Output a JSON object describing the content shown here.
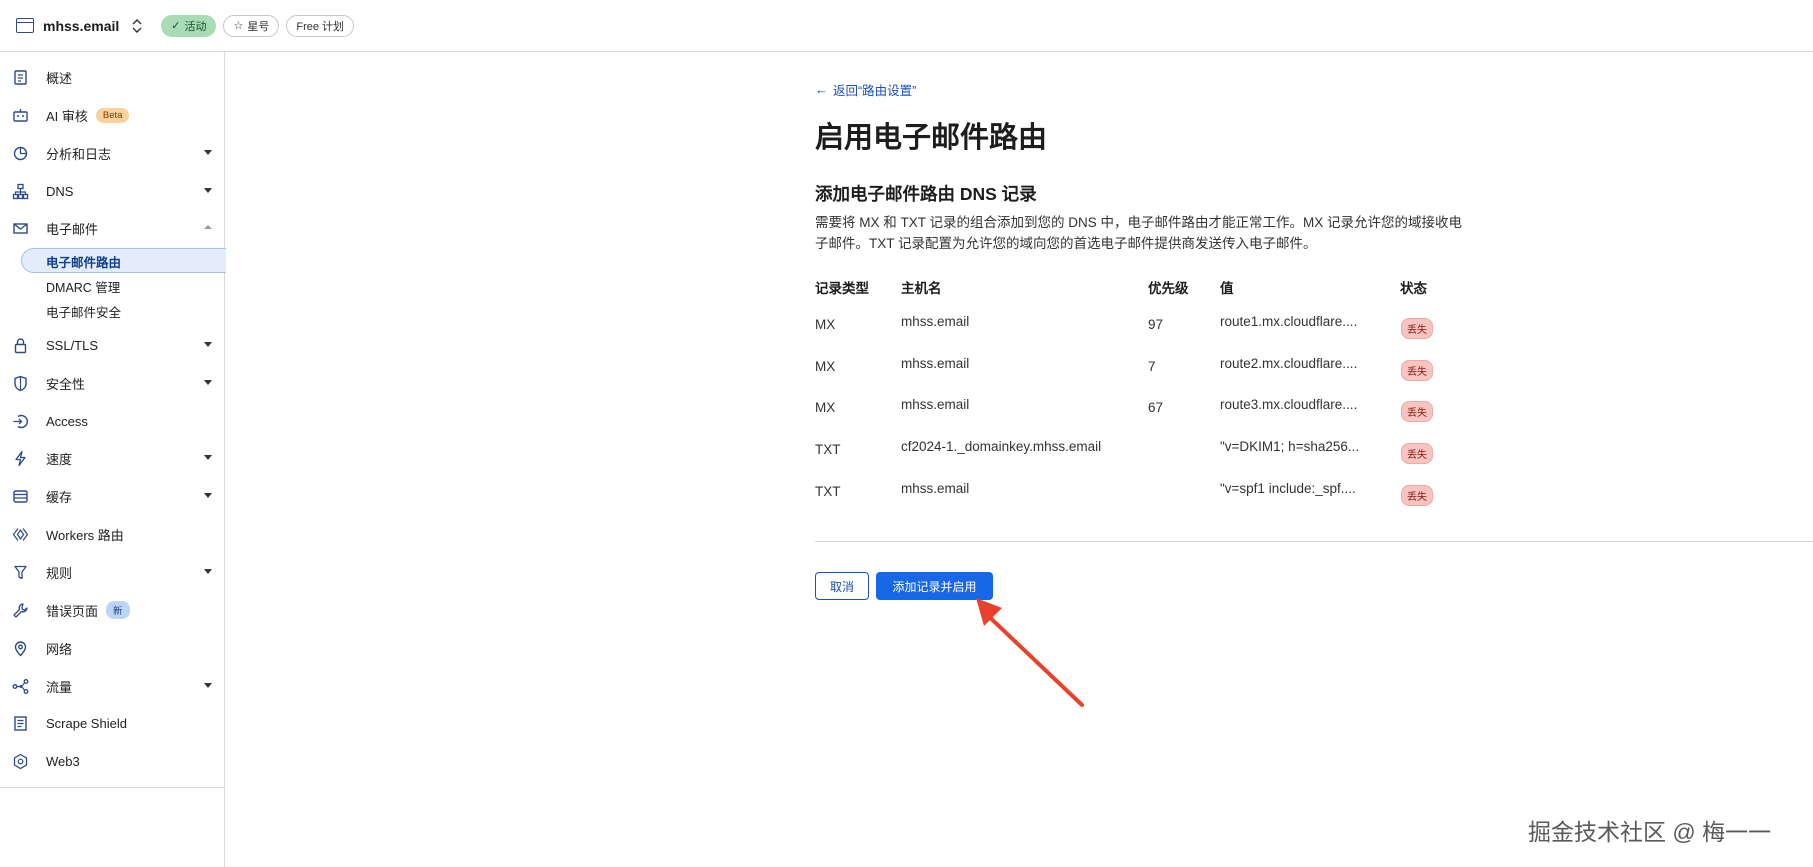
{
  "topbar": {
    "domain": "mhss.email",
    "status_label": "活动",
    "star_label": "星号",
    "plan_label": "Free 计划"
  },
  "sidebar": {
    "items": [
      {
        "label": "概述",
        "icon": "document-icon"
      },
      {
        "label": "AI 审核",
        "icon": "robot-icon",
        "badge": "Beta"
      },
      {
        "label": "分析和日志",
        "icon": "chart-pie-icon"
      },
      {
        "label": "DNS",
        "icon": "network-tree-icon"
      },
      {
        "label": "电子邮件",
        "icon": "mail-icon"
      },
      {
        "label": "SSL/TLS",
        "icon": "lock-icon"
      },
      {
        "label": "安全性",
        "icon": "shield-icon"
      },
      {
        "label": "Access",
        "icon": "access-icon"
      },
      {
        "label": "速度",
        "icon": "lightning-icon"
      },
      {
        "label": "缓存",
        "icon": "storage-icon"
      },
      {
        "label": "Workers 路由",
        "icon": "workers-icon"
      },
      {
        "label": "规则",
        "icon": "rules-icon"
      },
      {
        "label": "错误页面",
        "icon": "wrench-icon",
        "badge": "新"
      },
      {
        "label": "网络",
        "icon": "location-pin-icon"
      },
      {
        "label": "流量",
        "icon": "traffic-icon"
      },
      {
        "label": "Scrape Shield",
        "icon": "scrape-shield-icon"
      },
      {
        "label": "Web3",
        "icon": "web3-icon"
      }
    ],
    "email_sub": [
      "电子邮件路由",
      "DMARC 管理",
      "电子邮件安全"
    ]
  },
  "main": {
    "back_link": "返回“路由设置”",
    "title": "启用电子邮件路由",
    "section_title": "添加电子邮件路由 DNS 记录",
    "description": "需要将 MX 和 TXT 记录的组合添加到您的 DNS 中，电子邮件路由才能正常工作。MX 记录允许您的域接收电子邮件。TXT 记录配置为允许您的域向您的首选电子邮件提供商发送传入电子邮件。",
    "table": {
      "headers": [
        "记录类型",
        "主机名",
        "优先级",
        "值",
        "状态"
      ],
      "rows": [
        {
          "type": "MX",
          "host": "mhss.email",
          "priority": "97",
          "value": "route1.mx.cloudflare....",
          "status": "丢失"
        },
        {
          "type": "MX",
          "host": "mhss.email",
          "priority": "7",
          "value": "route2.mx.cloudflare....",
          "status": "丢失"
        },
        {
          "type": "MX",
          "host": "mhss.email",
          "priority": "67",
          "value": "route3.mx.cloudflare....",
          "status": "丢失"
        },
        {
          "type": "TXT",
          "host": "cf2024-1._domainkey.mhss.email",
          "priority": "",
          "value": "\"v=DKIM1; h=sha256...",
          "status": "丢失"
        },
        {
          "type": "TXT",
          "host": "mhss.email",
          "priority": "",
          "value": "\"v=spf1 include:_spf....",
          "status": "丢失"
        }
      ]
    },
    "cancel_label": "取消",
    "submit_label": "添加记录并启用"
  },
  "watermark": "掘金技术社区 @ 梅一一",
  "colors": {
    "accent": "#1767e6",
    "link": "#1b4fbf",
    "active_green": "#a8dcb4",
    "missing_red": "#f7c4c0",
    "annotation_arrow": "#e8412c"
  }
}
